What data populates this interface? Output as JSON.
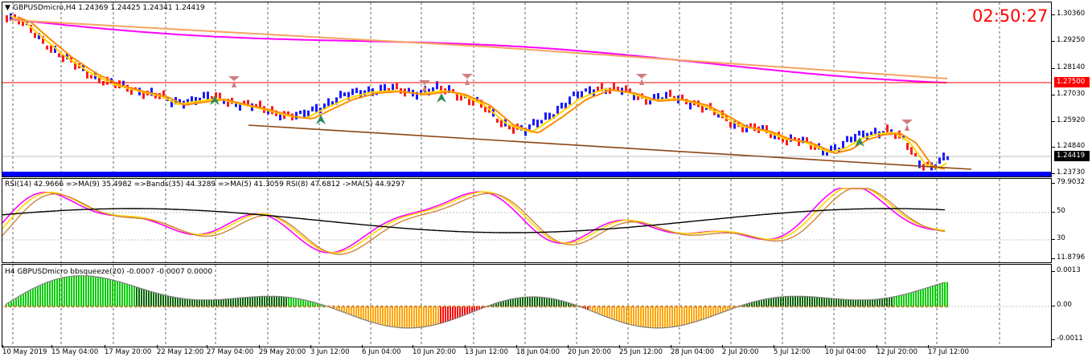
{
  "symbol_header": "GBPUSDmicro,H4  1.24369 1.24425 1.24341 1.24419",
  "timer": "02:50:27",
  "rsi_header": "RSI(14) 42.9666  =>MA(9) 35.4982  =>Bands(35) 44.3289  =>MA(5) 41.3059  RSI(8) 47.6812  ->MA(5) 44.9297",
  "bbsq_header": "H4 GBPUSDmicro bbsqueeze(20) -0.0007 -0.0007 0.0000",
  "price_axis": [
    "1.30360",
    "1.29250",
    "1.28140",
    "1.27030",
    "1.25920",
    "1.24840",
    "1.23730"
  ],
  "hline_price": "1.27500",
  "current_price": "1.24419",
  "rsi_axis": [
    "79.9032",
    "50",
    "30",
    "11.8796"
  ],
  "bbsq_axis": [
    "0.0013",
    "0.00",
    "-0.0011"
  ],
  "time_axis": [
    "10 May 2019",
    "15 May 04:00",
    "17 May 20:00",
    "22 May 12:00",
    "27 May 04:00",
    "29 May 20:00",
    "3 Jun 12:00",
    "6 Jun 04:00",
    "10 Jun 20:00",
    "13 Jun 12:00",
    "18 Jun 04:00",
    "20 Jun 20:00",
    "25 Jun 12:00",
    "28 Jun 04:00",
    "2 Jul 20:00",
    "5 Jul 12:00",
    "10 Jul 04:00",
    "12 Jul 20:00",
    "17 Jul 12:00"
  ],
  "colors": {
    "bull_bar": "#1a1aff",
    "bear_bar": "#ff1a1a",
    "ema_slow": "#ff00ff",
    "ema_long": "#f4a460",
    "hline": "#ff0000",
    "blue_band": "#0000ff",
    "timer": "#ff0000"
  }
}
